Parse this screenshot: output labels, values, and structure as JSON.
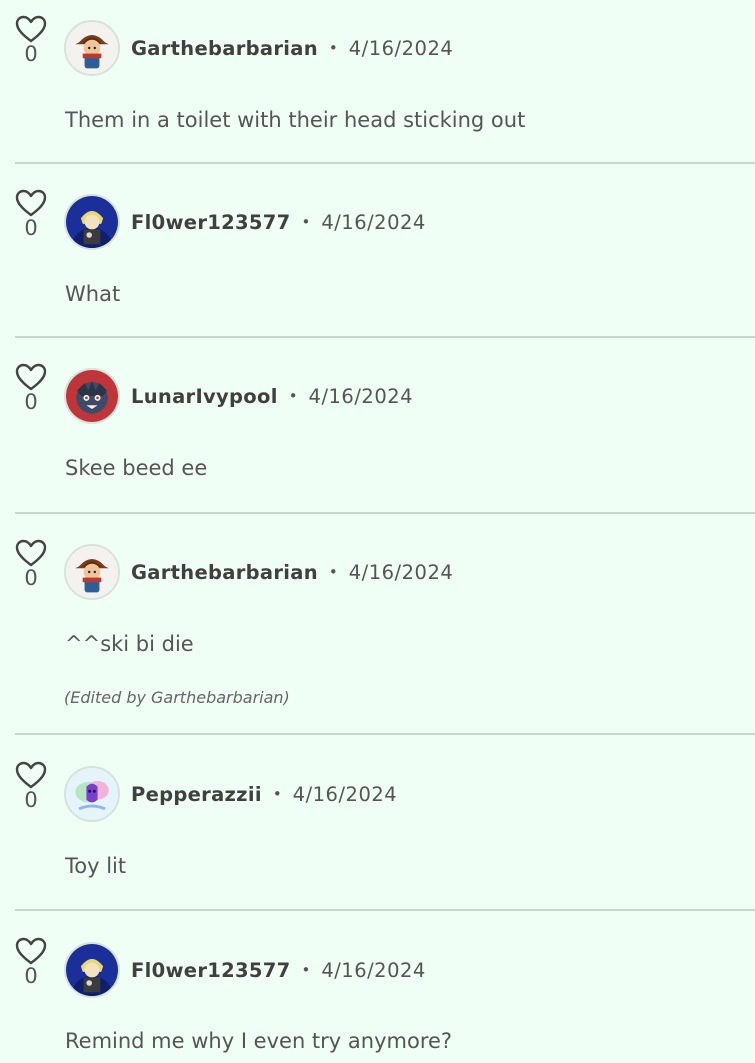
{
  "comments": [
    {
      "user": "Garthebarbarian",
      "separator": "•",
      "date": "4/16/2024",
      "likes": "0",
      "text": "Them in a toilet with their head sticking out",
      "edited": ""
    },
    {
      "user": "Fl0wer123577",
      "separator": "•",
      "date": "4/16/2024",
      "likes": "0",
      "text": "What",
      "edited": ""
    },
    {
      "user": "LunarIvypool",
      "separator": "•",
      "date": "4/16/2024",
      "likes": "0",
      "text": "Skee beed ee",
      "edited": ""
    },
    {
      "user": "Garthebarbarian",
      "separator": "•",
      "date": "4/16/2024",
      "likes": "0",
      "text": "^^ski bi die",
      "edited": "(Edited by Garthebarbarian)"
    },
    {
      "user": "Pepperazzii",
      "separator": "•",
      "date": "4/16/2024",
      "likes": "0",
      "text": "Toy lit",
      "edited": ""
    },
    {
      "user": "Fl0wer123577",
      "separator": "•",
      "date": "4/16/2024",
      "likes": "0",
      "text": "Remind me why I even try anymore?",
      "edited": ""
    }
  ],
  "icons": {
    "like": "heart-outline-icon"
  },
  "colors": {
    "background": "#effff5",
    "divider": "#c9d6cf",
    "text": "#555555"
  }
}
